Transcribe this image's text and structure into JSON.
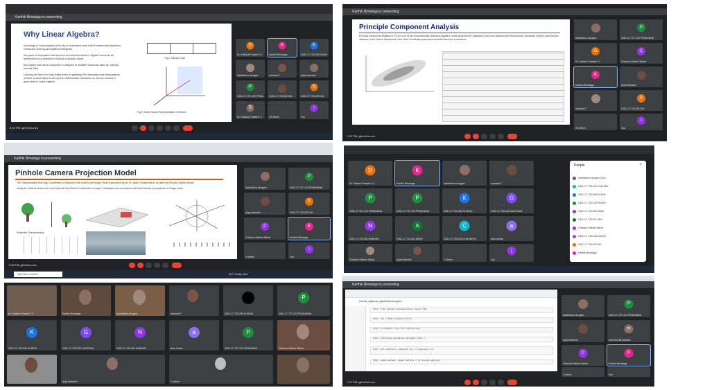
{
  "meet": {
    "presenting": "Karthik Bimalaga is presenting",
    "code": "gfm-fhdr-nxo",
    "time_1": "6:16 PM",
    "time_2": "7:02 PM",
    "time_3": "7:05 PM",
    "time_4": "7:07 PM"
  },
  "slide1": {
    "title": "Why Linear Algebra?",
    "bullets": [
      "Knowledge of Linear Algebra is the key to understand most of the Fundamental Algorithms of Machine Learning and Artificial Intelligence.",
      "Any piece of Information that has been recorded and stored in Digital Format can be represented as a collection of Vectors in Abstract Space.",
      "Any system that has its component is designed to emulate Human like tasks by Learning from the Data.",
      "Learning the Task from Data Solely relies on gathering The information and Manipulations of these Vectors which is built upon in Mathematical Operations on Vectors covered in great detail in Linear Algebra."
    ],
    "fig1": "Fig 1 Tabular Data",
    "fig2": "Fig 2 Vector Space Representation of Record"
  },
  "slide2": {
    "title": "Principle Component Analysis",
    "bullets": [
      "Principle component Analysis or PCA is one of the Dimensionality reduction Algorithm which projects the Datapoints onto a low dimensional Orthonormal Coordinate System such that the Variance of the Data is Maximized in the New Coordinate space and reconstruction loss is minimum."
    ]
  },
  "slide3": {
    "title": "Pinhole Camera Projection Model",
    "bullets": [
      "The Transformation that map Coordinates of Objects in real world to the Image Plane is governed by set of Linear Transformation as given By Pinhole Camera Model.",
      "Using the Camera Model one could Map the Real World Coordinates to Image Coordinates and reconstruct real world scenes by sequence of Image Views."
    ],
    "sub": "Projective Transformation"
  },
  "participants": [
    {
      "name": "Dr. Krishna Prasad K V",
      "initial": "D",
      "color": "#e8710a"
    },
    {
      "name": "Karthik Bimalaga",
      "initial": "K",
      "color": "#e52592"
    },
    {
      "name": "harikrishna devgam",
      "initial": "",
      "color": "#5f6368"
    },
    {
      "name": "manasa P",
      "initial": "",
      "color": "#5f6368"
    },
    {
      "name": "2401-17-737-123 PRASANNA",
      "initial": "P",
      "color": "#1e8e3e"
    },
    {
      "name": "2401-17-733-060 KUSHAL",
      "initial": "K",
      "color": "#1a73e8"
    },
    {
      "name": "priya dharshni",
      "initial": "",
      "color": "#5f6368"
    },
    {
      "name": "2401-17-733-002 SAI",
      "initial": "S",
      "color": "#e8710a"
    },
    {
      "name": "Chandra Sekhar Bishal",
      "initial": "C",
      "color": "#9334e6"
    },
    {
      "name": "18 others",
      "initial": "",
      "color": "#5f6368"
    },
    {
      "name": "You",
      "initial": "i",
      "color": "#9334e6"
    },
    {
      "name": "2401-17-733-043 GAUTHAM",
      "initial": "G",
      "color": "#7c4dff"
    },
    {
      "name": "2401-17-733-054 NANDAN",
      "initial": "N",
      "color": "#9334e6"
    },
    {
      "name": "2401-17-733-001 ARUN",
      "initial": "A",
      "color": "#137333"
    },
    {
      "name": "2401-17-733-015 CHAITANYA",
      "initial": "C",
      "color": "#12b5cb"
    },
    {
      "name": "arun kumar",
      "initial": "a",
      "color": "#8e6ff2"
    },
    {
      "name": "3 others",
      "initial": "",
      "color": "#5f6368"
    },
    {
      "name": "7 others",
      "initial": "",
      "color": "#5f6368"
    },
    {
      "name": "mani shivaji ananthu",
      "initial": "m",
      "color": "#8d6e63"
    }
  ],
  "people_panel": {
    "title": "People",
    "rows": [
      "harikrishna devgam (You)",
      "2401-17-733-015 CHAITAN",
      "2401-17-733-060 KUSHA",
      "2401-17-733-123 PRASA",
      "2401-17-733-054 NAND",
      "2401-17-733-001 ARU",
      "Chandra Sekhar Bishal",
      "2401-17-733-043 GAUTH",
      "2401-17-733-002 SAI",
      "Karthik Bimalaga"
    ],
    "colors": [
      "#5f6368",
      "#12b5cb",
      "#1a73e8",
      "#1e8e3e",
      "#9334e6",
      "#137333",
      "#9334e6",
      "#7c4dff",
      "#e8710a",
      "#e52592"
    ]
  },
  "taskbar": {
    "search": "Type here to search",
    "weather": "26°C Mostly clear"
  },
  "code": {
    "notebook": "Linear_Algebra_Applications.ipynb",
    "lines": [
      "[31]: from sklearn.decomposition import PCA",
      "[32]: pca = PCA(n_components=2)",
      "[33]: X_reduced = pca.fit_transform(X)",
      "[34]: print(pca.explained_variance_ratio_)",
      "[35]: plt.scatter(X_reduced[:,0], X_reduced[:,1])",
      "[36]: eigen_values, eigen_vectors = np.linalg.eig(cov)"
    ]
  }
}
